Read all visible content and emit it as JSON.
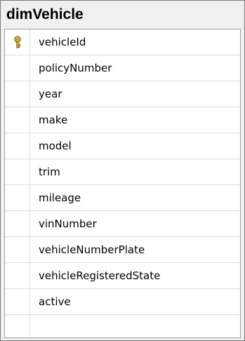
{
  "table": {
    "title": "dimVehicle",
    "columns": [
      {
        "name": "vehicleId",
        "primary_key": true,
        "icon": "key-icon"
      },
      {
        "name": "policyNumber",
        "primary_key": false
      },
      {
        "name": "year",
        "primary_key": false
      },
      {
        "name": "make",
        "primary_key": false
      },
      {
        "name": "model",
        "primary_key": false
      },
      {
        "name": "trim",
        "primary_key": false
      },
      {
        "name": "mileage",
        "primary_key": false
      },
      {
        "name": "vinNumber",
        "primary_key": false
      },
      {
        "name": "vehicleNumberPlate",
        "primary_key": false
      },
      {
        "name": "vehicleRegisteredState",
        "primary_key": false
      },
      {
        "name": "active",
        "primary_key": false
      }
    ]
  },
  "colors": {
    "header_background": "#f0f0f0",
    "key_icon": "#d4a017"
  }
}
